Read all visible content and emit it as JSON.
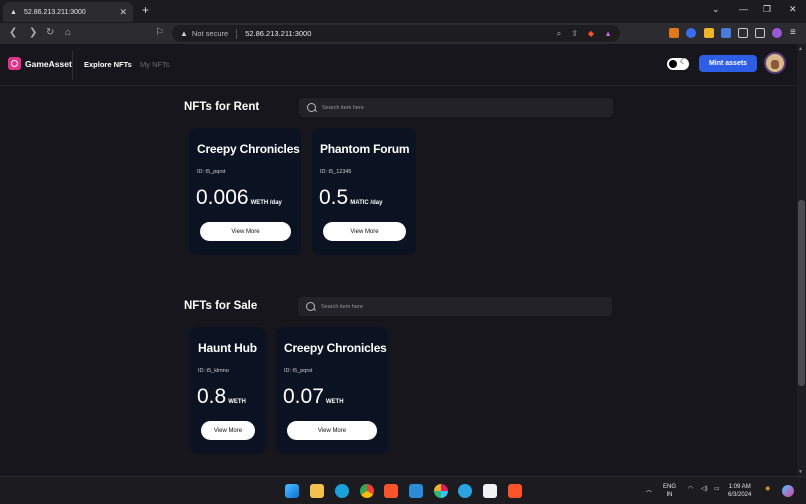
{
  "browser": {
    "tab_title": "52.86.213.211:3000",
    "security_label": "Not secure",
    "url": "52.86.213.211:3000"
  },
  "app": {
    "logo_text": "GameAsset",
    "nav": [
      {
        "label": "Explore NFTs"
      },
      {
        "label": "My NFTs"
      }
    ],
    "mint_label": "Mint assets"
  },
  "rent": {
    "title": "NFTs for Rent",
    "search_placeholder": "Search item here",
    "cards": [
      {
        "name": "Creepy Chronicles",
        "id": "ID: t5_pqrst",
        "price": "0.006",
        "unit": "WETH /day",
        "button": "View More"
      },
      {
        "name": "Phantom Forum",
        "id": "ID: t5_12345",
        "price": "0.5",
        "unit": "MATIC /day",
        "button": "View More"
      }
    ]
  },
  "sale": {
    "title": "NFTs for Sale",
    "search_placeholder": "Search item here",
    "cards": [
      {
        "name": "Haunt Hub",
        "id": "ID: t5_klmno",
        "price": "0.8",
        "unit": "WETH",
        "button": "View More"
      },
      {
        "name": "Creepy Chronicles",
        "id": "ID: t5_pqrst",
        "price": "0.07",
        "unit": "WETH",
        "button": "View More"
      }
    ]
  },
  "taskbar": {
    "lang_top": "ENG",
    "lang_bottom": "IN",
    "time": "1:09 AM",
    "date": "6/3/2024"
  },
  "colors": {
    "accent": "#2f5ee6",
    "logo": "#e0338a",
    "card_bg": "#0b1322",
    "page_bg": "#16161c"
  }
}
